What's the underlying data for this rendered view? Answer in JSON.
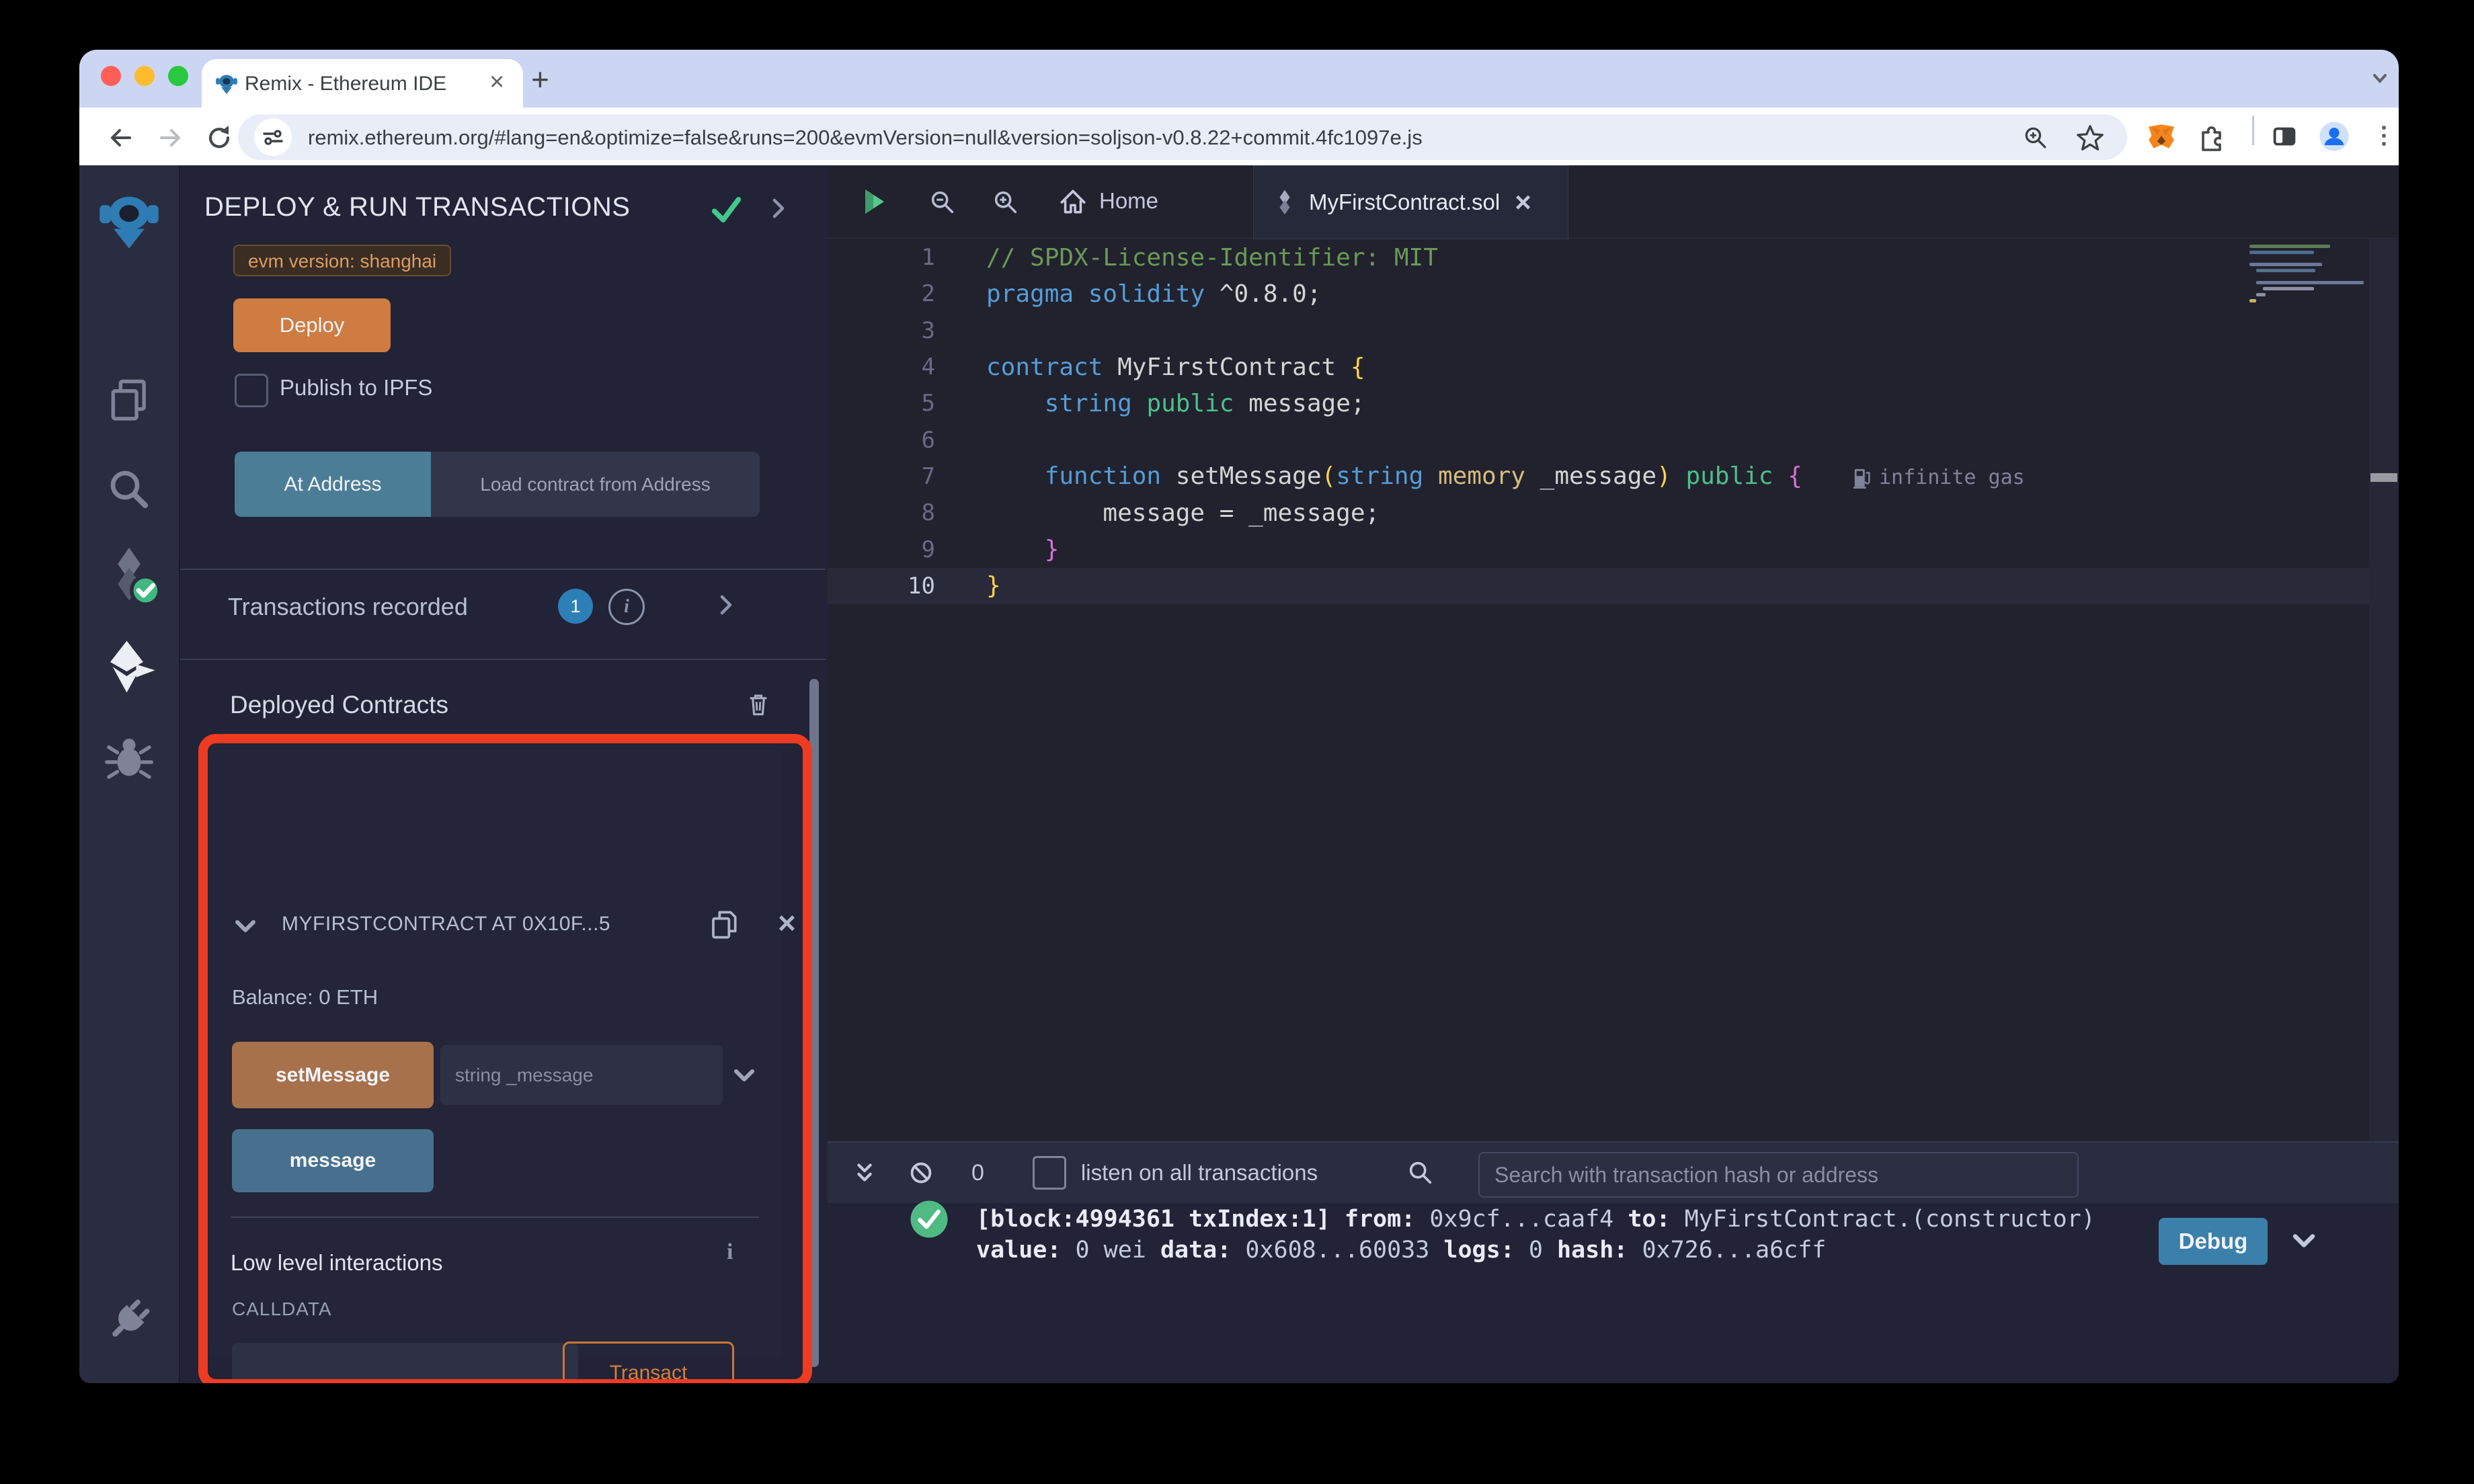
{
  "browser": {
    "tab_title": "Remix - Ethereum IDE",
    "url": "remix.ethereum.org/#lang=en&optimize=false&runs=200&evmVersion=null&version=soljson-v0.8.22+commit.4fc1097e.js"
  },
  "panel": {
    "title": "DEPLOY & RUN TRANSACTIONS",
    "evm_badge": "evm version: shanghai",
    "deploy_label": "Deploy",
    "publish_label": "Publish to IPFS",
    "at_address_label": "At Address",
    "load_contract_label": "Load contract from Address",
    "transactions_recorded": "Transactions recorded",
    "tx_badge": "1",
    "info_glyph": "i",
    "deployed_contracts": "Deployed Contracts",
    "contract": {
      "title": "MYFIRSTCONTRACT AT 0X10F...5",
      "balance": "Balance: 0 ETH",
      "set_message_label": "setMessage",
      "set_message_placeholder": "string _message",
      "message_label": "message",
      "low_level": "Low level interactions",
      "calldata_label": "CALLDATA",
      "transact_label": "Transact"
    }
  },
  "editor": {
    "home_tab": "Home",
    "file_tab": "MyFirstContract.sol",
    "gas_annotation": "infinite gas",
    "code_lines": [
      [
        [
          "// SPDX-License-Identifier: MIT",
          "c"
        ]
      ],
      [
        [
          "pragma",
          "k"
        ],
        [
          " ",
          "p"
        ],
        [
          "solidity",
          "k"
        ],
        [
          " ^0.8.0;",
          "p"
        ]
      ],
      [],
      [
        [
          "contract",
          "k"
        ],
        [
          " MyFirstContract ",
          "p"
        ],
        [
          "{",
          "y"
        ]
      ],
      [
        [
          "    ",
          "p"
        ],
        [
          "string",
          "k"
        ],
        [
          " ",
          "p"
        ],
        [
          "public",
          "g"
        ],
        [
          " message;",
          "p"
        ]
      ],
      [],
      [
        [
          "    ",
          "p"
        ],
        [
          "function",
          "k"
        ],
        [
          " setMessage",
          "p"
        ],
        [
          "(",
          "y"
        ],
        [
          "string",
          "k"
        ],
        [
          " ",
          "p"
        ],
        [
          "memory",
          "o"
        ],
        [
          " _message",
          "p"
        ],
        [
          ")",
          "y"
        ],
        [
          " ",
          "p"
        ],
        [
          "public",
          "g"
        ],
        [
          " ",
          "p"
        ],
        [
          "{",
          "m"
        ]
      ],
      [
        [
          "        message = _message;",
          "p"
        ]
      ],
      [
        [
          "    ",
          "p"
        ],
        [
          "}",
          "m"
        ]
      ],
      [
        [
          "}",
          "y"
        ]
      ]
    ]
  },
  "terminal": {
    "tx_count": "0",
    "listen_label": "listen on all transactions",
    "search_placeholder": "Search with transaction hash or address",
    "debug_label": "Debug",
    "prompt": ">",
    "log_line1": [
      [
        "[block:4994361 txIndex:1] ",
        "b"
      ],
      [
        "from: ",
        "b"
      ],
      [
        "0x9cf...caaf4 ",
        "n"
      ],
      [
        "to: ",
        "b"
      ],
      [
        "MyFirstContract.(constructor) ",
        "n"
      ]
    ],
    "log_line2": [
      [
        "value: ",
        "b"
      ],
      [
        "0 wei ",
        "n"
      ],
      [
        "data: ",
        "b"
      ],
      [
        "0x608...60033 ",
        "n"
      ],
      [
        "logs: ",
        "b"
      ],
      [
        "0 ",
        "n"
      ],
      [
        "hash: ",
        "b"
      ],
      [
        "0x726...a6cff",
        "n"
      ]
    ]
  },
  "colors": {
    "highlight_red": "#ee3b22",
    "accent_orange": "#ce7c41",
    "teal_button": "#4b7d96",
    "steel_button": "#47708e",
    "debug_blue": "#3a80aa",
    "success_green": "#4fba83",
    "badge_blue": "#2d7fb8",
    "panel_bg": "#222336",
    "sidebar_bg": "#2a2c3f",
    "editor_bg": "#21222e"
  }
}
